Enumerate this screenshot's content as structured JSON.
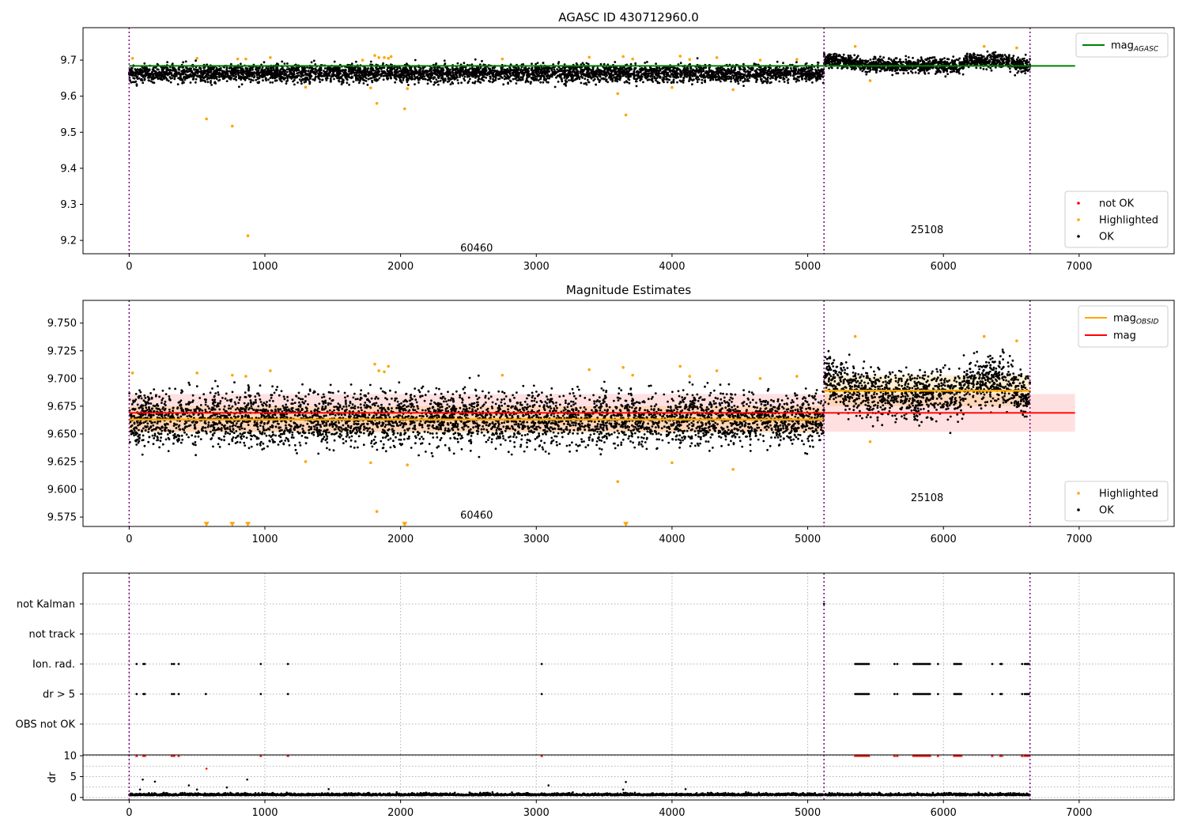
{
  "chart_data": [
    {
      "type": "scatter",
      "title": "AGASC ID 430712960.0",
      "xlabel": "",
      "ylabel": "",
      "xlim": [
        -340,
        7700
      ],
      "ylim": [
        9.163,
        9.79
      ],
      "grid": false,
      "xticks": [
        0,
        1000,
        2000,
        3000,
        4000,
        5000,
        6000,
        7000
      ],
      "yticks": [
        9.2,
        9.3,
        9.4,
        9.5,
        9.6,
        9.7
      ],
      "obsid_boundaries": [
        0,
        5120,
        6638
      ],
      "obsid_labels": [
        {
          "text": "60460",
          "x": 2560,
          "y": 9.17
        },
        {
          "text": "25108",
          "x": 5880,
          "y": 9.22
        }
      ],
      "reference_lines": [
        {
          "name": "mag",
          "subscript": "AGASC",
          "y": 9.684,
          "x": [
            0,
            6970
          ],
          "color": "#008000"
        }
      ],
      "ok_segments": [
        {
          "x": [
            0,
            5120
          ],
          "mean": 9.664,
          "spread": 0.012
        },
        {
          "x": [
            5120,
            6638
          ],
          "mean": 9.686,
          "spread": 0.01
        }
      ],
      "highlighted_points": {
        "x": [
          25,
          500,
          570,
          760,
          800,
          860,
          875,
          1040,
          1300,
          1720,
          1780,
          1810,
          1825,
          1840,
          1880,
          1910,
          1930,
          2030,
          2050,
          2750,
          3390,
          3600,
          3640,
          3660,
          3710,
          4000,
          4060,
          4130,
          4330,
          4450,
          4650,
          4920,
          5350,
          5460,
          6300,
          6540
        ],
        "y": [
          9.705,
          9.705,
          9.537,
          9.517,
          9.703,
          9.703,
          9.213,
          9.707,
          9.625,
          9.7,
          9.623,
          9.713,
          9.58,
          9.707,
          9.707,
          9.705,
          9.71,
          9.565,
          9.621,
          9.703,
          9.708,
          9.607,
          9.71,
          9.548,
          9.703,
          9.624,
          9.711,
          9.702,
          9.707,
          9.618,
          9.7,
          9.702,
          9.738,
          9.643,
          9.738,
          9.734
        ]
      },
      "legends": [
        {
          "placement": "upper right",
          "entries": [
            {
              "label": "mag",
              "subscript": "AGASC",
              "color": "#008000",
              "marker": "line"
            }
          ]
        },
        {
          "placement": "lower right",
          "entries": [
            {
              "label": "not OK",
              "color": "#ff0000",
              "marker": "dot"
            },
            {
              "label": "Highlighted",
              "color": "#ffa500",
              "marker": "dot"
            },
            {
              "label": "OK",
              "color": "#000000",
              "marker": "dot"
            }
          ]
        }
      ]
    },
    {
      "type": "scatter",
      "title": "Magnitude Estimates",
      "xlabel": "",
      "ylabel": "",
      "xlim": [
        -340,
        7700
      ],
      "ylim": [
        9.5665,
        9.7705
      ],
      "grid": false,
      "xticks": [
        0,
        1000,
        2000,
        3000,
        4000,
        5000,
        6000,
        7000
      ],
      "yticks": [
        9.575,
        9.6,
        9.625,
        9.65,
        9.675,
        9.7,
        9.725,
        9.75
      ],
      "obsid_boundaries": [
        0,
        5120,
        6638
      ],
      "obsid_labels": [
        {
          "text": "60460",
          "x": 2560,
          "y": 9.5735
        },
        {
          "text": "25108",
          "x": 5880,
          "y": 9.5895
        }
      ],
      "mag_band": {
        "name": "mag",
        "y": 9.669,
        "low": 9.652,
        "high": 9.686,
        "x": [
          0,
          6970
        ],
        "color": "#ff0000"
      },
      "obsid_estimates": [
        {
          "name": "mag",
          "subscript": "OBSID",
          "x": [
            0,
            5120
          ],
          "y": 9.663,
          "low": 9.651,
          "high": 9.675
        },
        {
          "name": "mag",
          "subscript": "OBSID",
          "x": [
            5120,
            6638
          ],
          "y": 9.689,
          "low": 9.675,
          "high": 9.703
        }
      ],
      "ok_segments": [
        {
          "x": [
            0,
            5120
          ],
          "mean": 9.664,
          "spread": 0.012
        },
        {
          "x": [
            5120,
            6638
          ],
          "mean": 9.686,
          "spread": 0.011
        }
      ],
      "highlighted_points": {
        "x": [
          25,
          500,
          760,
          860,
          1040,
          1300,
          1780,
          1810,
          1825,
          1840,
          1880,
          1910,
          2050,
          2750,
          3390,
          3600,
          3640,
          3710,
          4000,
          4060,
          4130,
          4330,
          4450,
          4650,
          4920,
          5350,
          5460,
          6300,
          6540
        ],
        "y": [
          9.705,
          9.705,
          9.703,
          9.702,
          9.707,
          9.625,
          9.624,
          9.713,
          9.58,
          9.707,
          9.706,
          9.711,
          9.622,
          9.703,
          9.708,
          9.607,
          9.71,
          9.703,
          9.624,
          9.711,
          9.702,
          9.707,
          9.618,
          9.7,
          9.702,
          9.738,
          9.643,
          9.738,
          9.734
        ]
      },
      "below_range_markers": {
        "x": [
          570,
          760,
          875,
          2030,
          3660
        ],
        "y": 9.5685
      },
      "legends": [
        {
          "placement": "upper right",
          "entries": [
            {
              "label": "mag",
              "subscript": "OBSID",
              "color": "#ffa500",
              "marker": "line"
            },
            {
              "label": "mag",
              "subscript": "",
              "color": "#ff0000",
              "marker": "line"
            }
          ]
        },
        {
          "placement": "lower right",
          "entries": [
            {
              "label": "Highlighted",
              "color": "#ffa500",
              "marker": "dot"
            },
            {
              "label": "OK",
              "color": "#000000",
              "marker": "dot"
            }
          ]
        }
      ]
    },
    {
      "type": "scatter",
      "title": "",
      "xlim": [
        -340,
        7700
      ],
      "grid": true,
      "obsid_boundaries": [
        0,
        5120,
        6638
      ],
      "flag_rows": [
        "not Kalman",
        "not track",
        "Ion. rad.",
        "dr > 5",
        "OBS not OK"
      ],
      "flags": {
        "Ion. rad.": [
          55,
          105,
          115,
          315,
          330,
          365,
          970,
          1170,
          3040,
          5350,
          5360,
          5370,
          5380,
          5390,
          5400,
          5410,
          5420,
          5430,
          5440,
          5450,
          5640,
          5660,
          5780,
          5790,
          5800,
          5810,
          5820,
          5830,
          5840,
          5850,
          5860,
          5870,
          5880,
          5890,
          5900,
          5960,
          6080,
          6090,
          6100,
          6110,
          6120,
          6130,
          6360,
          6420,
          6430,
          6580,
          6600,
          6610,
          6620,
          6630
        ],
        "dr > 5": [
          55,
          105,
          115,
          315,
          330,
          365,
          565,
          970,
          1170,
          3040,
          5350,
          5360,
          5370,
          5380,
          5390,
          5400,
          5410,
          5420,
          5430,
          5440,
          5450,
          5640,
          5660,
          5780,
          5790,
          5800,
          5810,
          5820,
          5830,
          5840,
          5850,
          5860,
          5870,
          5880,
          5890,
          5900,
          5960,
          6080,
          6090,
          6100,
          6110,
          6120,
          6130,
          6360,
          6420,
          6430,
          6580,
          6600,
          6610,
          6620,
          6630
        ],
        "not Kalman": [
          5120
        ],
        "not track": [],
        "OBS not OK": []
      }
    },
    {
      "type": "scatter",
      "title": "",
      "xlabel": "",
      "ylabel": "dr",
      "xlim": [
        -340,
        7700
      ],
      "ylim": [
        -0.6,
        10.2
      ],
      "grid": true,
      "xticks": [
        0,
        1000,
        2000,
        3000,
        4000,
        5000,
        6000,
        7000
      ],
      "yticks": [
        0,
        5,
        10
      ],
      "obsid_boundaries": [
        0,
        5120,
        6638
      ],
      "dr_baseline": {
        "mean": 0.5,
        "spread": 0.3
      },
      "outliers": {
        "x": [
          80,
          100,
          190,
          440,
          500,
          570,
          720,
          870,
          1470,
          3090,
          3640,
          3660,
          4100
        ],
        "y": [
          1.9,
          4.3,
          3.8,
          2.9,
          1.9,
          6.9,
          2.4,
          4.3,
          2.0,
          2.9,
          1.9,
          3.7,
          2.0
        ]
      },
      "clipped_points": {
        "x": [
          55,
          105,
          115,
          315,
          330,
          365,
          970,
          1170,
          3040,
          5350,
          5360,
          5370,
          5380,
          5390,
          5400,
          5410,
          5420,
          5430,
          5440,
          5450,
          5640,
          5660,
          5780,
          5790,
          5800,
          5810,
          5820,
          5830,
          5840,
          5850,
          5860,
          5870,
          5880,
          5890,
          5900,
          5960,
          6080,
          6090,
          6100,
          6110,
          6120,
          6130,
          6360,
          6420,
          6430,
          6580,
          6600,
          6610,
          6620,
          6630
        ],
        "y": 10
      }
    }
  ]
}
